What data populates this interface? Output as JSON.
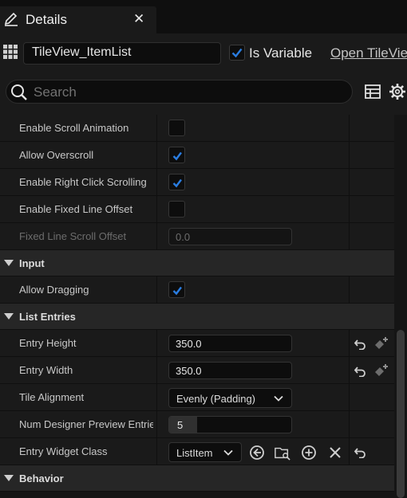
{
  "tab": {
    "title": "Details",
    "close": "✕"
  },
  "header": {
    "widget_name": "TileView_ItemList",
    "is_variable_label": "Is Variable",
    "is_variable_checked": true,
    "open_link": "Open TileView"
  },
  "search": {
    "placeholder": "Search"
  },
  "rows": [
    {
      "type": "prop",
      "label": "Enable Scroll Animation",
      "control": "checkbox",
      "checked": false
    },
    {
      "type": "prop",
      "label": "Allow Overscroll",
      "control": "checkbox",
      "checked": true
    },
    {
      "type": "prop",
      "label": "Enable Right Click Scrolling",
      "control": "checkbox",
      "checked": true
    },
    {
      "type": "prop",
      "label": "Enable Fixed Line Offset",
      "control": "checkbox",
      "checked": false
    },
    {
      "type": "prop",
      "label": "Fixed Line Scroll Offset",
      "control": "number",
      "value": "0.0",
      "disabled": true
    },
    {
      "type": "category",
      "label": "Input"
    },
    {
      "type": "prop",
      "label": "Allow Dragging",
      "control": "checkbox",
      "checked": true
    },
    {
      "type": "category",
      "label": "List Entries"
    },
    {
      "type": "prop",
      "label": "Entry Height",
      "control": "number",
      "value": "350.0",
      "reset": true
    },
    {
      "type": "prop",
      "label": "Entry Width",
      "control": "number",
      "value": "350.0",
      "reset": true
    },
    {
      "type": "prop",
      "label": "Tile Alignment",
      "control": "dropdown",
      "value": "Evenly (Padding)"
    },
    {
      "type": "prop",
      "label": "Num Designer Preview Entries",
      "control": "spin",
      "value": "5"
    },
    {
      "type": "prop",
      "label": "Entry Widget Class",
      "control": "class",
      "value": "ListItem",
      "reset": true
    },
    {
      "type": "category",
      "label": "Behavior"
    }
  ],
  "icons": {
    "tab": "pencil-icon",
    "header": "widget-grid-icon",
    "search": "search-icon",
    "toolbar": [
      "table-icon",
      "gear-icon"
    ]
  },
  "colors": {
    "accent": "#2a7de1",
    "background": "#1a1a1a",
    "category": "#262626"
  }
}
